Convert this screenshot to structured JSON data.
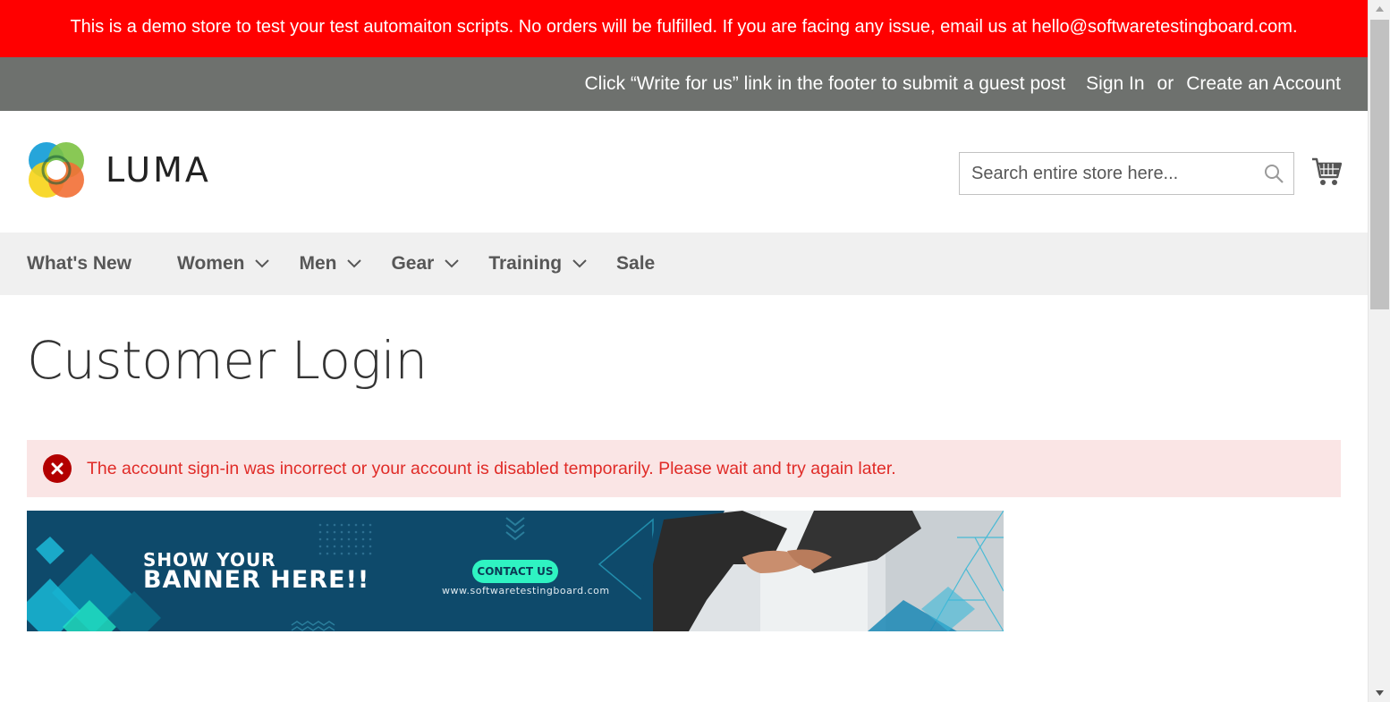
{
  "demo_notice": {
    "text": "This is a demo store to test your test automaiton scripts. No orders will be fulfilled. If you are facing any issue, email us at hello@softwaretestingboard.com."
  },
  "panel": {
    "promo": "Click “Write for us” link in the footer to submit a guest post",
    "sign_in": "Sign In",
    "or": "or",
    "create_account": "Create an Account"
  },
  "header": {
    "logo_text": "LUMA",
    "search_placeholder": "Search entire store here...",
    "search_icon": "search-icon",
    "cart_icon": "cart-icon"
  },
  "nav": {
    "items": [
      {
        "label": "What's New",
        "has_submenu": false
      },
      {
        "label": "Women",
        "has_submenu": true
      },
      {
        "label": "Men",
        "has_submenu": true
      },
      {
        "label": "Gear",
        "has_submenu": true
      },
      {
        "label": "Training",
        "has_submenu": true
      },
      {
        "label": "Sale",
        "has_submenu": false
      }
    ]
  },
  "main": {
    "title": "Customer Login",
    "error_message": "The account sign-in was incorrect or your account is disabled temporarily. Please wait and try again later.",
    "error_icon": "error-icon"
  },
  "banner": {
    "line1": "SHOW YOUR",
    "line2": "BANNER HERE!!",
    "button": "CONTACT US",
    "url": "www.softwaretestingboard.com"
  },
  "colors": {
    "notice_bg": "#ff0000",
    "panel_bg": "#6e716e",
    "nav_bg": "#f0f0f0",
    "error_bg": "#fae5e5",
    "error_text": "#e02b27",
    "banner_bg": "#0e4a6b",
    "banner_button": "#2ff3c2"
  }
}
